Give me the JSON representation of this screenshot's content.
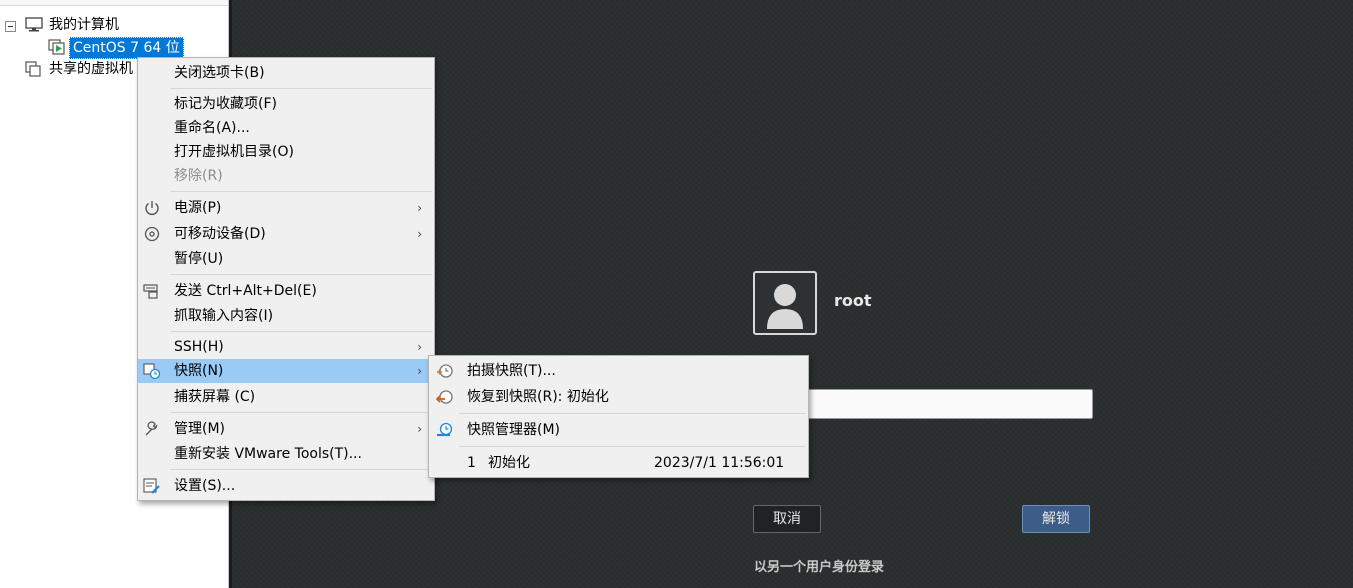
{
  "library": {
    "my_computer": "我的计算机",
    "vm_name": "CentOS 7 64 位",
    "shared_vms": "共享的虚拟机"
  },
  "console": {
    "username": "root",
    "password_placeholder": "",
    "cancel": "取消",
    "unlock": "解锁",
    "login_other": "以另一个用户身份登录"
  },
  "context_menu": {
    "close_tab": "关闭选项卡(B)",
    "mark_favorite": "标记为收藏项(F)",
    "rename": "重命名(A)...",
    "open_dir": "打开虚拟机目录(O)",
    "remove": "移除(R)",
    "power": "电源(P)",
    "removable": "可移动设备(D)",
    "pause": "暂停(U)",
    "send_cad": "发送 Ctrl+Alt+Del(E)",
    "grab_input": "抓取输入内容(I)",
    "ssh": "SSH(H)",
    "snapshot": "快照(N)",
    "capture_screen": "捕获屏幕 (C)",
    "manage": "管理(M)",
    "reinstall_tools": "重新安装 VMware Tools(T)...",
    "settings": "设置(S)..."
  },
  "snapshot_menu": {
    "take": "拍摄快照(T)...",
    "revert": "恢复到快照(R): 初始化",
    "manager": "快照管理器(M)",
    "item_index": "1",
    "item_name": "初始化",
    "item_date": "2023/7/1 11:56:01"
  },
  "colors": {
    "console_bg": "#2b2e2f",
    "highlight": "#99cbf6",
    "selection": "#0078d7",
    "unlock_btn": "#3c5d88"
  }
}
